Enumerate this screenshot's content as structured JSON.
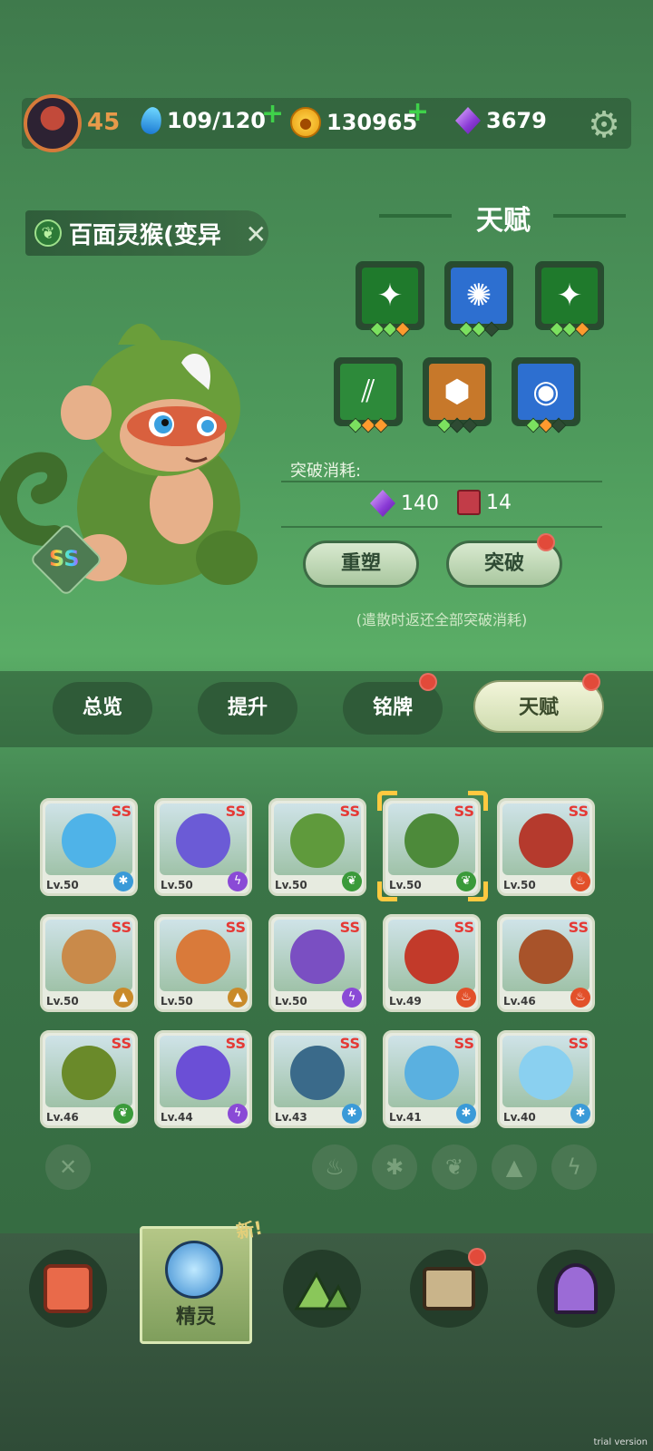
{
  "header": {
    "level": "45",
    "stamina": "109/120",
    "coins": "130965",
    "gems": "3679"
  },
  "pet": {
    "name": "百面灵猴(变异",
    "rank": "SS"
  },
  "talent": {
    "title": "天赋",
    "slots": [
      {
        "icon": "green-spike-icon",
        "color": "#1f7a2c",
        "dots": [
          "g",
          "g",
          "o"
        ]
      },
      {
        "icon": "blue-gear-icon",
        "color": "#2d6fd0",
        "dots": [
          "g",
          "g",
          "k"
        ]
      },
      {
        "icon": "green-spike-icon",
        "color": "#1f7a2c",
        "dots": [
          "g",
          "g",
          "o"
        ]
      },
      {
        "icon": "green-claw-icon",
        "color": "#2d8a3a",
        "dots": [
          "g",
          "o",
          "o"
        ]
      },
      {
        "icon": "red-shield-icon",
        "color": "#c7782a",
        "dots": [
          "g",
          "k",
          "k"
        ]
      },
      {
        "icon": "blue-eye-icon",
        "color": "#2d6fd0",
        "dots": [
          "g",
          "o",
          "k"
        ]
      }
    ],
    "cost_label": "突破消耗:",
    "cost_gems": "140",
    "cost_books": "14",
    "reset_button": "重塑",
    "break_button": "突破",
    "note": "(遣散时返还全部突破消耗)"
  },
  "tabs": {
    "overview": "总览",
    "upgrade": "提升",
    "plate": "铭牌",
    "talent": "天赋"
  },
  "cards": [
    {
      "lv": "Lv.50",
      "rank": "SS",
      "element": "ice",
      "color": "#4fb3e8"
    },
    {
      "lv": "Lv.50",
      "rank": "SS",
      "element": "thunder",
      "color": "#6b5bd6"
    },
    {
      "lv": "Lv.50",
      "rank": "SS",
      "element": "grass",
      "color": "#5f9a3c"
    },
    {
      "lv": "Lv.50",
      "rank": "SS",
      "element": "grass",
      "color": "#4d8a3a"
    },
    {
      "lv": "Lv.50",
      "rank": "SS",
      "element": "fire",
      "color": "#b53a2d"
    },
    {
      "lv": "Lv.50",
      "rank": "SS",
      "element": "earth",
      "color": "#c98a4a"
    },
    {
      "lv": "Lv.50",
      "rank": "SS",
      "element": "earth",
      "color": "#d97a3a"
    },
    {
      "lv": "Lv.50",
      "rank": "SS",
      "element": "thunder",
      "color": "#7a4fc2"
    },
    {
      "lv": "Lv.49",
      "rank": "SS",
      "element": "fire",
      "color": "#c23a2a"
    },
    {
      "lv": "Lv.46",
      "rank": "SS",
      "element": "fire",
      "color": "#a8532a"
    },
    {
      "lv": "Lv.46",
      "rank": "SS",
      "element": "grass",
      "color": "#6a8a2a"
    },
    {
      "lv": "Lv.44",
      "rank": "SS",
      "element": "thunder",
      "color": "#6b4fd6"
    },
    {
      "lv": "Lv.43",
      "rank": "SS",
      "element": "ice",
      "color": "#3a6a8a"
    },
    {
      "lv": "Lv.41",
      "rank": "SS",
      "element": "ice",
      "color": "#5ab0e0"
    },
    {
      "lv": "Lv.40",
      "rank": "SS",
      "element": "ice",
      "color": "#8ad0f0"
    }
  ],
  "nav": {
    "spirit_label": "精灵",
    "new_tag": "新!"
  },
  "watermark": "trial version"
}
